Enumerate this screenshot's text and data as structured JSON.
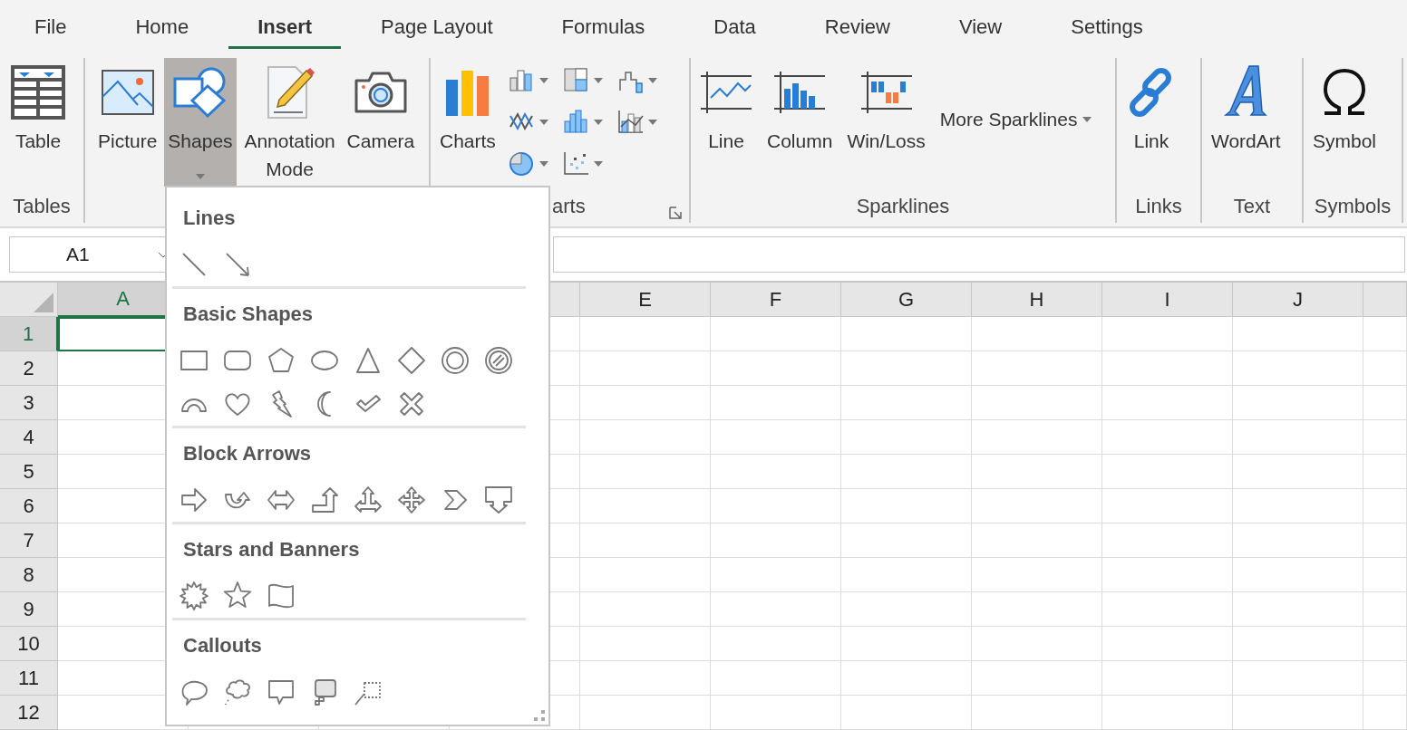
{
  "tabs": [
    {
      "label": "File",
      "selected": false
    },
    {
      "label": "Home",
      "selected": false
    },
    {
      "label": "Insert",
      "selected": true
    },
    {
      "label": "Page Layout",
      "selected": false
    },
    {
      "label": "Formulas",
      "selected": false
    },
    {
      "label": "Data",
      "selected": false
    },
    {
      "label": "Review",
      "selected": false
    },
    {
      "label": "View",
      "selected": false
    },
    {
      "label": "Settings",
      "selected": false
    }
  ],
  "ribbon": {
    "groups": [
      {
        "label": "Tables",
        "buttons": [
          {
            "label": "Table",
            "kind": "table",
            "pressed": false,
            "has_menu": false
          }
        ]
      },
      {
        "buttons": [
          {
            "label": "Picture",
            "kind": "picture",
            "pressed": false,
            "has_menu": false
          },
          {
            "label": "Shapes",
            "kind": "shapes",
            "pressed": true,
            "has_menu": true
          },
          {
            "label": "Annotation Mode",
            "kind": "annotation",
            "pressed": false,
            "has_menu": false
          },
          {
            "label": "Camera",
            "kind": "camera",
            "pressed": false,
            "has_menu": false
          }
        ]
      },
      {
        "label": "arts",
        "buttons": [
          {
            "label": "Charts",
            "kind": "charts",
            "pressed": false,
            "has_menu": false
          }
        ],
        "small_charts": true,
        "launcher": true
      },
      {
        "label": "Sparklines",
        "buttons": [
          {
            "label": "Line",
            "kind": "spark-line",
            "pressed": false,
            "has_menu": false
          },
          {
            "label": "Column",
            "kind": "spark-column",
            "pressed": false,
            "has_menu": false
          },
          {
            "label": "Win/Loss",
            "kind": "spark-winloss",
            "pressed": false,
            "has_menu": false
          },
          {
            "label": "More Sparklines",
            "kind": "text-menu",
            "pressed": false,
            "has_menu": true
          }
        ]
      },
      {
        "label": "Links",
        "buttons": [
          {
            "label": "Link",
            "kind": "link",
            "pressed": false,
            "has_menu": false
          }
        ]
      },
      {
        "label": "Text",
        "buttons": [
          {
            "label": "WordArt",
            "kind": "wordart",
            "pressed": false,
            "has_menu": false
          }
        ]
      },
      {
        "label": "Symbols",
        "buttons": [
          {
            "label": "Symbol",
            "kind": "symbol",
            "pressed": false,
            "has_menu": false
          }
        ]
      }
    ]
  },
  "name_box": {
    "value": "A1"
  },
  "grid": {
    "columns": [
      {
        "label": "A",
        "selected": true
      },
      {
        "label": "E",
        "selected": false
      },
      {
        "label": "F",
        "selected": false
      },
      {
        "label": "G",
        "selected": false
      },
      {
        "label": "H",
        "selected": false
      },
      {
        "label": "I",
        "selected": false
      },
      {
        "label": "J",
        "selected": false
      },
      {
        "selected": false
      }
    ],
    "rows": [
      {
        "label": "1",
        "selected": true
      },
      {
        "label": "2",
        "selected": false
      },
      {
        "label": "3",
        "selected": false
      },
      {
        "label": "4",
        "selected": false
      },
      {
        "label": "5",
        "selected": false
      },
      {
        "label": "6",
        "selected": false
      },
      {
        "label": "7",
        "selected": false
      },
      {
        "label": "8",
        "selected": false
      },
      {
        "label": "9",
        "selected": false
      },
      {
        "label": "10",
        "selected": false
      },
      {
        "label": "11",
        "selected": false
      },
      {
        "label": "12",
        "selected": false
      }
    ]
  },
  "shapes_menu": {
    "sections": [
      {
        "title": "Lines",
        "shapes": [
          {
            "kind": "line"
          },
          {
            "kind": "arrow-line"
          }
        ]
      },
      {
        "title": "Basic Shapes",
        "shapes": [
          {
            "kind": "rectangle"
          },
          {
            "kind": "rounded-rectangle"
          },
          {
            "kind": "pentagon"
          },
          {
            "kind": "oval"
          },
          {
            "kind": "triangle"
          },
          {
            "kind": "diamond"
          },
          {
            "kind": "donut"
          },
          {
            "kind": "no-symbol"
          },
          {
            "kind": "block-arc"
          },
          {
            "kind": "heart"
          },
          {
            "kind": "lightning"
          },
          {
            "kind": "moon"
          },
          {
            "kind": "check"
          },
          {
            "kind": "cross"
          }
        ]
      },
      {
        "title": "Block Arrows",
        "shapes": [
          {
            "kind": "right-arrow"
          },
          {
            "kind": "u-turn-arrow"
          },
          {
            "kind": "left-right-arrow"
          },
          {
            "kind": "bent-up-arrow"
          },
          {
            "kind": "left-right-up-arrow"
          },
          {
            "kind": "quad-arrow"
          },
          {
            "kind": "chevron"
          },
          {
            "kind": "down-arrow-callout"
          }
        ]
      },
      {
        "title": "Stars and Banners",
        "shapes": [
          {
            "kind": "explosion"
          },
          {
            "kind": "star"
          },
          {
            "kind": "wave"
          }
        ]
      },
      {
        "title": "Callouts",
        "shapes": [
          {
            "kind": "oval-callout"
          },
          {
            "kind": "cloud-callout"
          },
          {
            "kind": "rectangle-callout"
          },
          {
            "kind": "flowchart-callout"
          },
          {
            "kind": "line-callout"
          }
        ]
      }
    ]
  }
}
